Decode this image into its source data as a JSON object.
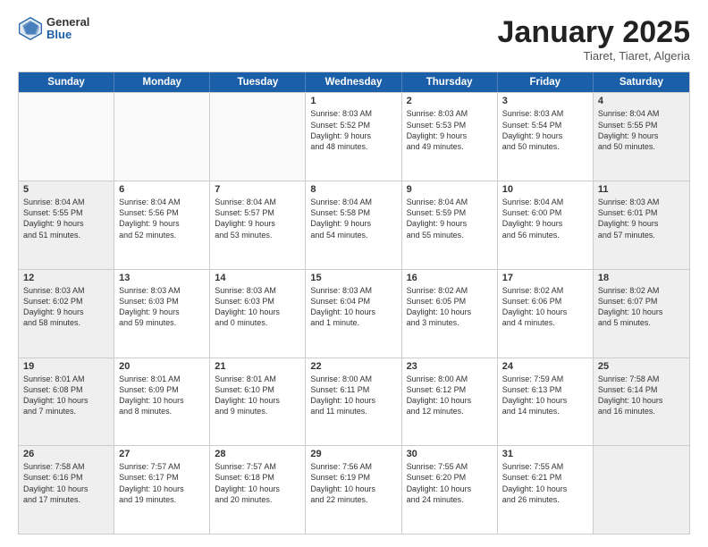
{
  "header": {
    "logo_general": "General",
    "logo_blue": "Blue",
    "month": "January 2025",
    "location": "Tiaret, Tiaret, Algeria"
  },
  "days_of_week": [
    "Sunday",
    "Monday",
    "Tuesday",
    "Wednesday",
    "Thursday",
    "Friday",
    "Saturday"
  ],
  "weeks": [
    [
      {
        "day": "",
        "empty": true
      },
      {
        "day": "",
        "empty": true
      },
      {
        "day": "",
        "empty": true
      },
      {
        "day": "1",
        "lines": [
          "Sunrise: 8:03 AM",
          "Sunset: 5:52 PM",
          "Daylight: 9 hours",
          "and 48 minutes."
        ]
      },
      {
        "day": "2",
        "lines": [
          "Sunrise: 8:03 AM",
          "Sunset: 5:53 PM",
          "Daylight: 9 hours",
          "and 49 minutes."
        ]
      },
      {
        "day": "3",
        "lines": [
          "Sunrise: 8:03 AM",
          "Sunset: 5:54 PM",
          "Daylight: 9 hours",
          "and 50 minutes."
        ]
      },
      {
        "day": "4",
        "shaded": true,
        "lines": [
          "Sunrise: 8:04 AM",
          "Sunset: 5:55 PM",
          "Daylight: 9 hours",
          "and 50 minutes."
        ]
      }
    ],
    [
      {
        "day": "5",
        "shaded": true,
        "lines": [
          "Sunrise: 8:04 AM",
          "Sunset: 5:55 PM",
          "Daylight: 9 hours",
          "and 51 minutes."
        ]
      },
      {
        "day": "6",
        "lines": [
          "Sunrise: 8:04 AM",
          "Sunset: 5:56 PM",
          "Daylight: 9 hours",
          "and 52 minutes."
        ]
      },
      {
        "day": "7",
        "lines": [
          "Sunrise: 8:04 AM",
          "Sunset: 5:57 PM",
          "Daylight: 9 hours",
          "and 53 minutes."
        ]
      },
      {
        "day": "8",
        "lines": [
          "Sunrise: 8:04 AM",
          "Sunset: 5:58 PM",
          "Daylight: 9 hours",
          "and 54 minutes."
        ]
      },
      {
        "day": "9",
        "lines": [
          "Sunrise: 8:04 AM",
          "Sunset: 5:59 PM",
          "Daylight: 9 hours",
          "and 55 minutes."
        ]
      },
      {
        "day": "10",
        "lines": [
          "Sunrise: 8:04 AM",
          "Sunset: 6:00 PM",
          "Daylight: 9 hours",
          "and 56 minutes."
        ]
      },
      {
        "day": "11",
        "shaded": true,
        "lines": [
          "Sunrise: 8:03 AM",
          "Sunset: 6:01 PM",
          "Daylight: 9 hours",
          "and 57 minutes."
        ]
      }
    ],
    [
      {
        "day": "12",
        "shaded": true,
        "lines": [
          "Sunrise: 8:03 AM",
          "Sunset: 6:02 PM",
          "Daylight: 9 hours",
          "and 58 minutes."
        ]
      },
      {
        "day": "13",
        "lines": [
          "Sunrise: 8:03 AM",
          "Sunset: 6:03 PM",
          "Daylight: 9 hours",
          "and 59 minutes."
        ]
      },
      {
        "day": "14",
        "lines": [
          "Sunrise: 8:03 AM",
          "Sunset: 6:03 PM",
          "Daylight: 10 hours",
          "and 0 minutes."
        ]
      },
      {
        "day": "15",
        "lines": [
          "Sunrise: 8:03 AM",
          "Sunset: 6:04 PM",
          "Daylight: 10 hours",
          "and 1 minute."
        ]
      },
      {
        "day": "16",
        "lines": [
          "Sunrise: 8:02 AM",
          "Sunset: 6:05 PM",
          "Daylight: 10 hours",
          "and 3 minutes."
        ]
      },
      {
        "day": "17",
        "lines": [
          "Sunrise: 8:02 AM",
          "Sunset: 6:06 PM",
          "Daylight: 10 hours",
          "and 4 minutes."
        ]
      },
      {
        "day": "18",
        "shaded": true,
        "lines": [
          "Sunrise: 8:02 AM",
          "Sunset: 6:07 PM",
          "Daylight: 10 hours",
          "and 5 minutes."
        ]
      }
    ],
    [
      {
        "day": "19",
        "shaded": true,
        "lines": [
          "Sunrise: 8:01 AM",
          "Sunset: 6:08 PM",
          "Daylight: 10 hours",
          "and 7 minutes."
        ]
      },
      {
        "day": "20",
        "lines": [
          "Sunrise: 8:01 AM",
          "Sunset: 6:09 PM",
          "Daylight: 10 hours",
          "and 8 minutes."
        ]
      },
      {
        "day": "21",
        "lines": [
          "Sunrise: 8:01 AM",
          "Sunset: 6:10 PM",
          "Daylight: 10 hours",
          "and 9 minutes."
        ]
      },
      {
        "day": "22",
        "lines": [
          "Sunrise: 8:00 AM",
          "Sunset: 6:11 PM",
          "Daylight: 10 hours",
          "and 11 minutes."
        ]
      },
      {
        "day": "23",
        "lines": [
          "Sunrise: 8:00 AM",
          "Sunset: 6:12 PM",
          "Daylight: 10 hours",
          "and 12 minutes."
        ]
      },
      {
        "day": "24",
        "lines": [
          "Sunrise: 7:59 AM",
          "Sunset: 6:13 PM",
          "Daylight: 10 hours",
          "and 14 minutes."
        ]
      },
      {
        "day": "25",
        "shaded": true,
        "lines": [
          "Sunrise: 7:58 AM",
          "Sunset: 6:14 PM",
          "Daylight: 10 hours",
          "and 16 minutes."
        ]
      }
    ],
    [
      {
        "day": "26",
        "shaded": true,
        "lines": [
          "Sunrise: 7:58 AM",
          "Sunset: 6:16 PM",
          "Daylight: 10 hours",
          "and 17 minutes."
        ]
      },
      {
        "day": "27",
        "lines": [
          "Sunrise: 7:57 AM",
          "Sunset: 6:17 PM",
          "Daylight: 10 hours",
          "and 19 minutes."
        ]
      },
      {
        "day": "28",
        "lines": [
          "Sunrise: 7:57 AM",
          "Sunset: 6:18 PM",
          "Daylight: 10 hours",
          "and 20 minutes."
        ]
      },
      {
        "day": "29",
        "lines": [
          "Sunrise: 7:56 AM",
          "Sunset: 6:19 PM",
          "Daylight: 10 hours",
          "and 22 minutes."
        ]
      },
      {
        "day": "30",
        "lines": [
          "Sunrise: 7:55 AM",
          "Sunset: 6:20 PM",
          "Daylight: 10 hours",
          "and 24 minutes."
        ]
      },
      {
        "day": "31",
        "lines": [
          "Sunrise: 7:55 AM",
          "Sunset: 6:21 PM",
          "Daylight: 10 hours",
          "and 26 minutes."
        ]
      },
      {
        "day": "",
        "empty": true,
        "shaded": true
      }
    ]
  ]
}
